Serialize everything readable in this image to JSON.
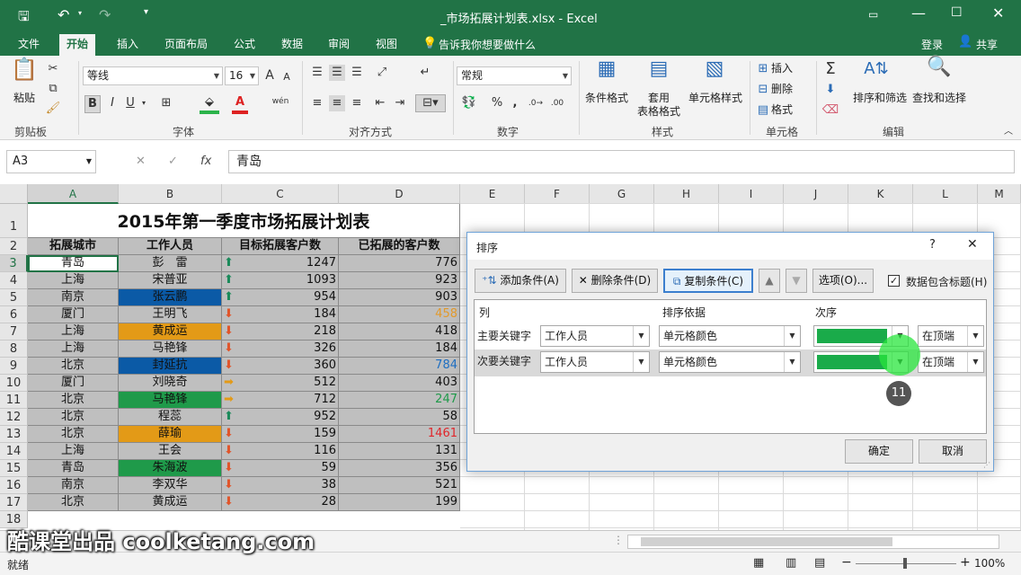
{
  "app": {
    "filename": "_市场拓展计划表.xlsx - Excel",
    "login": "登录",
    "share": "共享",
    "tellme": "告诉我你想要做什么"
  },
  "tabs": [
    "文件",
    "开始",
    "插入",
    "页面布局",
    "公式",
    "数据",
    "审阅",
    "视图"
  ],
  "ribbon": {
    "paste": "粘贴",
    "clipboard": "剪贴板",
    "font_name": "等线",
    "font_size": "16",
    "font_group": "字体",
    "align_group": "对齐方式",
    "number_format": "常规",
    "number_group": "数字",
    "cond_format": "条件格式",
    "table_format_1": "套用",
    "table_format_2": "表格格式",
    "cell_style": "单元格样式",
    "style_group": "样式",
    "insert": "插入",
    "delete": "删除",
    "format": "格式",
    "cells_group": "单元格",
    "sort_filter": "排序和筛选",
    "find_select": "查找和选择",
    "edit_group": "编辑",
    "bold": "B",
    "italic": "I",
    "underline": "U",
    "font_color_letter": "A",
    "wen": "wén",
    "pct": "%",
    "comma": ",",
    "growA": "A",
    "shrinkA": "A"
  },
  "formula": {
    "namebox": "A3",
    "fx": "fx",
    "content": "青岛",
    "cancel": "✕",
    "enter": "✓"
  },
  "columns": [
    "A",
    "B",
    "C",
    "D",
    "E",
    "F",
    "G",
    "H",
    "I",
    "J",
    "K",
    "L",
    "M"
  ],
  "rows": [
    "1",
    "2",
    "3",
    "4",
    "5",
    "6",
    "7",
    "8",
    "9",
    "10",
    "11",
    "12",
    "13",
    "14",
    "15",
    "16",
    "17",
    "18"
  ],
  "sheet": {
    "title": "2015年第一季度市场拓展计划表",
    "headers": [
      "拓展城市",
      "工作人员",
      "目标拓展客户数",
      "已拓展的客户数"
    ],
    "data": [
      {
        "city": "青岛",
        "person": "彭　雷",
        "target": "1247",
        "done": "776",
        "fill": "#bfbfbf",
        "doneColor": "#111",
        "icon": "up"
      },
      {
        "city": "上海",
        "person": "宋普亚",
        "target": "1093",
        "done": "923",
        "fill": "#bfbfbf",
        "doneColor": "#111",
        "icon": "up"
      },
      {
        "city": "南京",
        "person": "张云鹏",
        "target": "954",
        "done": "903",
        "fill": "#0b5aa6",
        "doneColor": "#111",
        "icon": "up"
      },
      {
        "city": "厦门",
        "person": "王明飞",
        "target": "184",
        "done": "458",
        "fill": "#bfbfbf",
        "doneColor": "#e39a2b",
        "icon": "down"
      },
      {
        "city": "上海",
        "person": "黄成运",
        "target": "218",
        "done": "418",
        "fill": "#e39a17",
        "doneColor": "#111",
        "icon": "down"
      },
      {
        "city": "上海",
        "person": "马艳锋",
        "target": "326",
        "done": "184",
        "fill": "#bfbfbf",
        "doneColor": "#111",
        "icon": "down"
      },
      {
        "city": "北京",
        "person": "封延抗",
        "target": "360",
        "done": "784",
        "fill": "#0b5aa6",
        "doneColor": "#1f6fc2",
        "icon": "down"
      },
      {
        "city": "厦门",
        "person": "刘晓奇",
        "target": "512",
        "done": "403",
        "fill": "#bfbfbf",
        "doneColor": "#111",
        "icon": "right"
      },
      {
        "city": "北京",
        "person": "马艳锋",
        "target": "712",
        "done": "247",
        "fill": "#1f9a4a",
        "doneColor": "#1f9a4a",
        "icon": "right"
      },
      {
        "city": "北京",
        "person": "程蕊",
        "target": "952",
        "done": "58",
        "fill": "#bfbfbf",
        "doneColor": "#111",
        "icon": "up"
      },
      {
        "city": "北京",
        "person": "薛瑜",
        "target": "159",
        "done": "1461",
        "fill": "#e39a17",
        "doneColor": "#e0262b",
        "icon": "down"
      },
      {
        "city": "上海",
        "person": "王会",
        "target": "116",
        "done": "131",
        "fill": "#bfbfbf",
        "doneColor": "#111",
        "icon": "down"
      },
      {
        "city": "青岛",
        "person": "朱海波",
        "target": "59",
        "done": "356",
        "fill": "#1f9a4a",
        "doneColor": "#111",
        "icon": "down"
      },
      {
        "city": "南京",
        "person": "李双华",
        "target": "38",
        "done": "521",
        "fill": "#bfbfbf",
        "doneColor": "#111",
        "icon": "down"
      },
      {
        "city": "北京",
        "person": "黄成运",
        "target": "28",
        "done": "199",
        "fill": "#bfbfbf",
        "doneColor": "#111",
        "icon": "down"
      }
    ]
  },
  "dialog": {
    "title": "排序",
    "help": "?",
    "close": "✕",
    "add": "添加条件(A)",
    "delete": "删除条件(D)",
    "copy": "复制条件(C)",
    "options": "选项(O)...",
    "hasheader": "数据包含标题(H)",
    "col_header": "列",
    "basis_header": "排序依据",
    "order_header": "次序",
    "primary": "主要关键字",
    "secondary": "次要关键字",
    "primary_col": "工作人员",
    "primary_basis": "单元格颜色",
    "primary_pos": "在顶端",
    "secondary_col": "工作人员",
    "secondary_basis": "单元格颜色",
    "secondary_pos": "在顶端",
    "ok": "确定",
    "cancel": "取消",
    "swatch": "#1aab4a"
  },
  "badge": "11",
  "status": {
    "ready": "就绪",
    "zoom": "100%",
    "plus": "+",
    "minus": "−"
  },
  "watermark": "酷课堂出品 coolketang.com"
}
